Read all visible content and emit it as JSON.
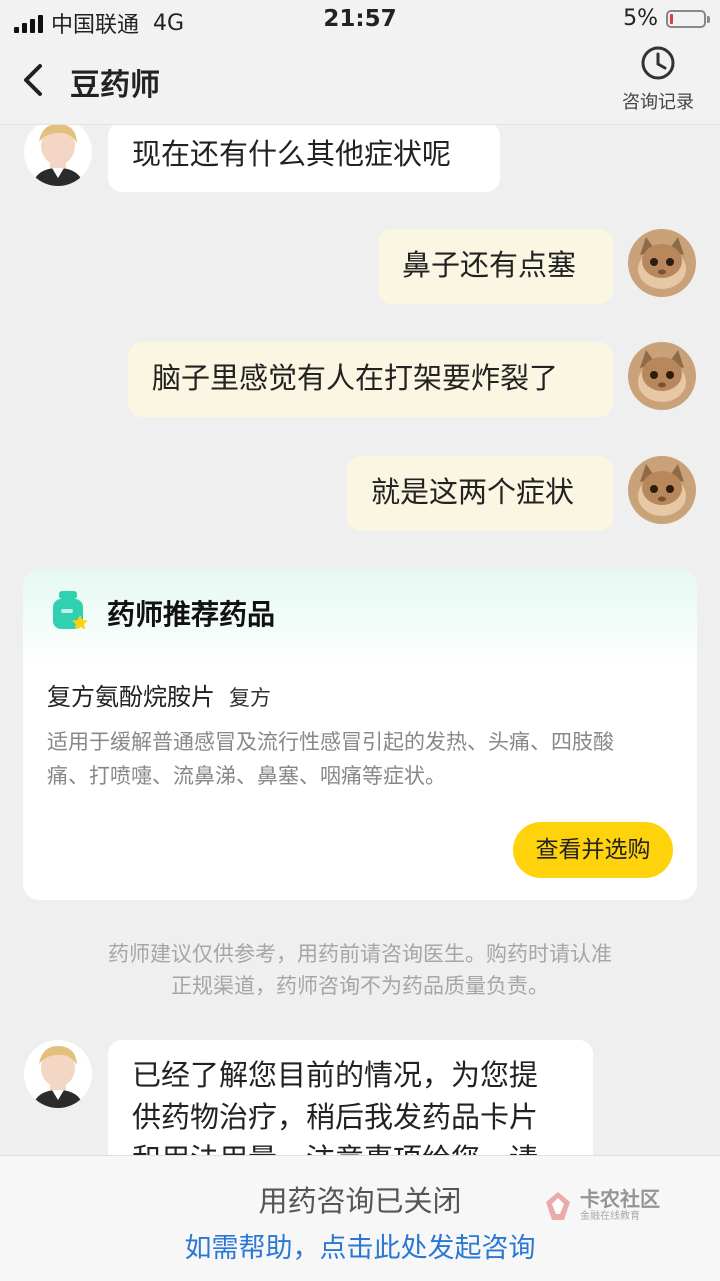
{
  "status_bar": {
    "carrier": "中国联通",
    "network": "4G",
    "time": "21:57",
    "battery": "5%"
  },
  "nav": {
    "title": "豆药师",
    "history_label": "咨询记录"
  },
  "messages": [
    {
      "side": "left",
      "text": "现在还有什么其他症状呢"
    },
    {
      "side": "right",
      "text": "鼻子还有点塞"
    },
    {
      "side": "right",
      "text": "脑子里感觉有人在打架要炸裂了"
    },
    {
      "side": "right",
      "text": "就是这两个症状"
    },
    {
      "side": "left",
      "lines": [
        "已经了解您目前的情况，为您提",
        "供药物治疗，稍后我发药品卡片",
        "和用法用量、注意事项给您，请"
      ]
    }
  ],
  "card": {
    "title": "药师推荐药品",
    "drug_name": "复方氨酚烷胺片",
    "drug_tag": "复方",
    "description_lines": [
      "适用于缓解普通感冒及流行性感冒引起的发热、头痛、四肢酸",
      "痛、打喷嚏、流鼻涕、鼻塞、咽痛等症状。"
    ],
    "button_label": "查看并选购"
  },
  "disclaimer_lines": [
    "药师建议仅供参考，用药前请咨询医生。购药时请认准",
    "正规渠道，药师咨询不为药品质量负责。"
  ],
  "footer": {
    "closed_text": "用药咨询已关闭",
    "help_text": "如需帮助，点击此处发起咨询"
  },
  "watermark": {
    "main": "卡农社区",
    "sub": "金融在线教育"
  },
  "colors": {
    "accent_yellow": "#ffd30c",
    "link_blue": "#2b78d4",
    "card_teal": "#2fd1b0",
    "user_bubble": "#fbf6e2"
  }
}
